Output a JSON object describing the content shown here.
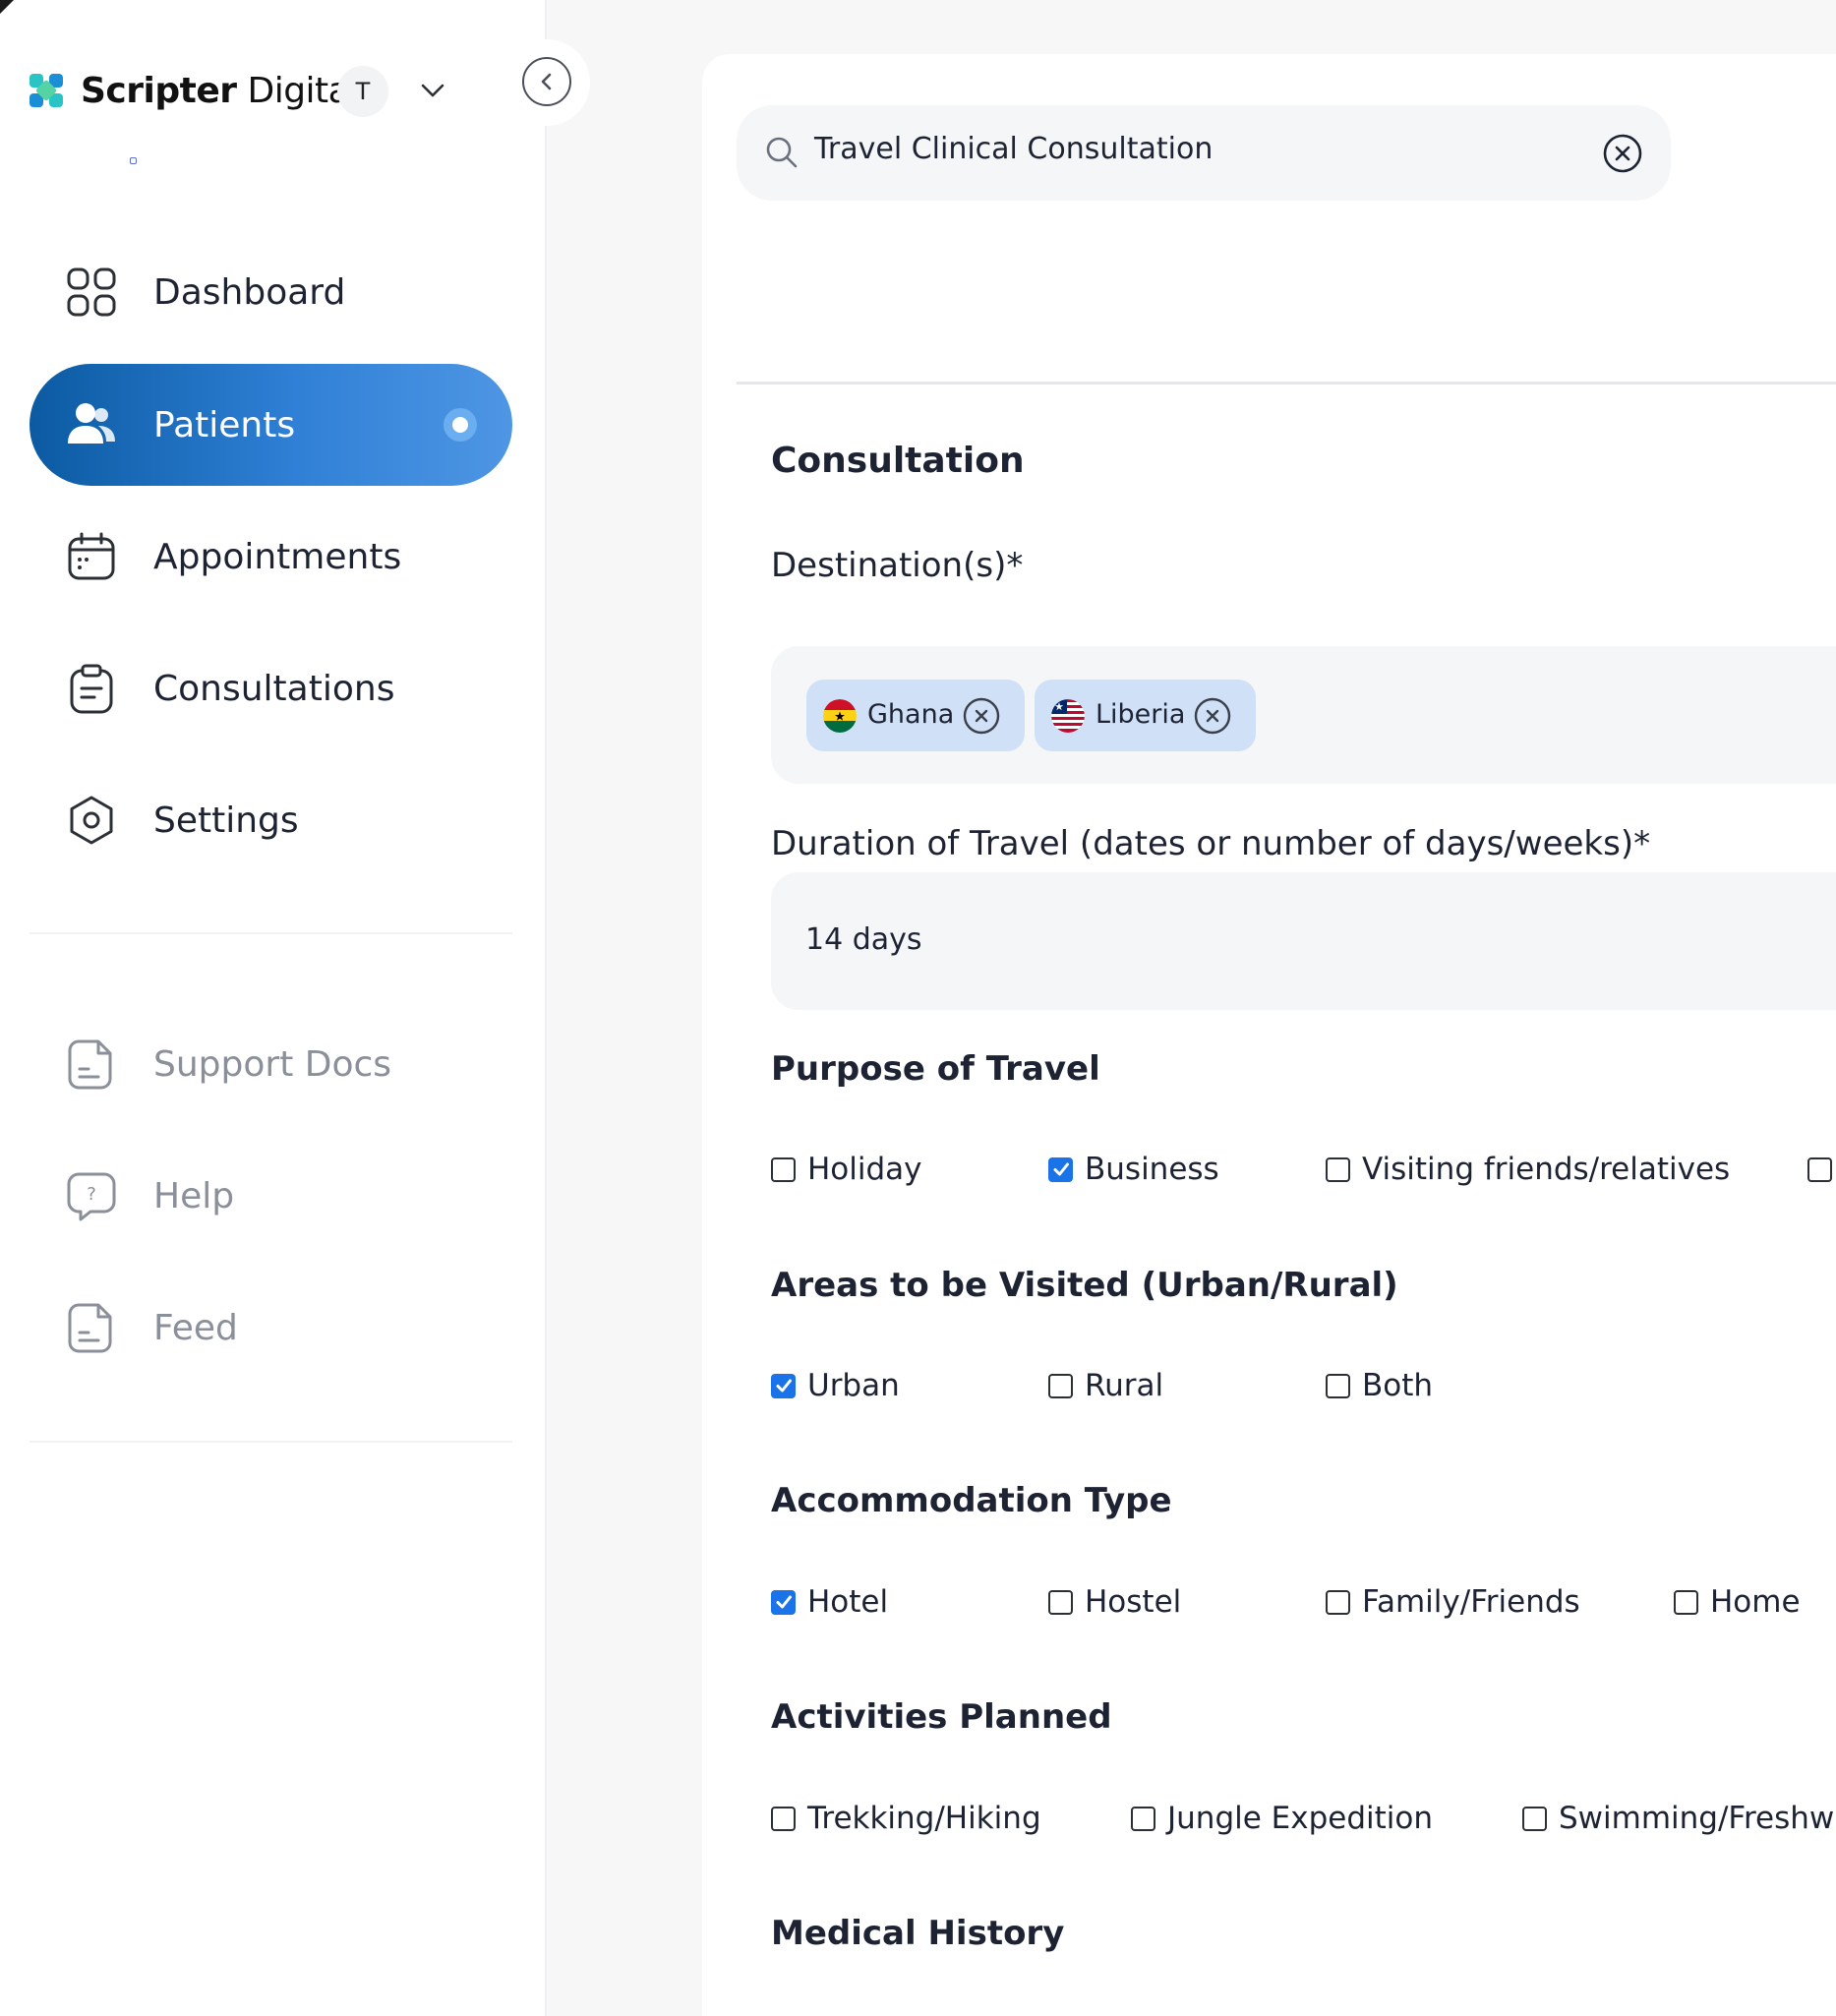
{
  "brand": {
    "name_bold": "Scripter",
    "name_light": "Digital",
    "avatar_initial": "T"
  },
  "nav": {
    "main": [
      {
        "label": "Dashboard",
        "icon": "grid-icon",
        "active": false
      },
      {
        "label": "Patients",
        "icon": "users-icon",
        "active": true
      },
      {
        "label": "Appointments",
        "icon": "calendar-icon",
        "active": false
      },
      {
        "label": "Consultations",
        "icon": "clipboard-icon",
        "active": false
      },
      {
        "label": "Settings",
        "icon": "gear-hexagon-icon",
        "active": false
      }
    ],
    "secondary": [
      {
        "label": "Support Docs",
        "icon": "document-icon"
      },
      {
        "label": "Help",
        "icon": "help-bubble-icon"
      },
      {
        "label": "Feed",
        "icon": "feed-document-icon"
      }
    ]
  },
  "search": {
    "value": "Travel Clinical Consultation"
  },
  "form": {
    "title": "Consultation",
    "destinations_label": "Destination(s)*",
    "destinations": [
      {
        "name": "Ghana",
        "flag": "ghana-flag"
      },
      {
        "name": "Liberia",
        "flag": "liberia-flag"
      }
    ],
    "duration_label": "Duration of Travel (dates or number of days/weeks)*",
    "duration_value": "14 days",
    "purpose": {
      "title": "Purpose of Travel",
      "options": [
        {
          "label": "Holiday",
          "checked": false
        },
        {
          "label": "Business",
          "checked": true
        },
        {
          "label": "Visiting friends/relatives",
          "checked": false
        },
        {
          "label": "",
          "checked": false
        }
      ]
    },
    "areas": {
      "title": "Areas to be Visited (Urban/Rural)",
      "options": [
        {
          "label": "Urban",
          "checked": true
        },
        {
          "label": "Rural",
          "checked": false
        },
        {
          "label": "Both",
          "checked": false
        }
      ]
    },
    "accommodation": {
      "title": "Accommodation Type",
      "options": [
        {
          "label": "Hotel",
          "checked": true
        },
        {
          "label": "Hostel",
          "checked": false
        },
        {
          "label": "Family/Friends",
          "checked": false
        },
        {
          "label": "Home",
          "checked": false
        }
      ]
    },
    "activities": {
      "title": "Activities Planned",
      "options": [
        {
          "label": "Trekking/Hiking",
          "checked": false
        },
        {
          "label": "Jungle Expedition",
          "checked": false
        },
        {
          "label": "Swimming/Freshwa",
          "checked": false
        }
      ]
    },
    "medical_history_title": "Medical History"
  },
  "colors": {
    "accent": "#1a73e8",
    "nav_active_start": "#0b5aa2",
    "nav_active_end": "#4f96e4",
    "chip_bg": "#cfe0f7"
  }
}
